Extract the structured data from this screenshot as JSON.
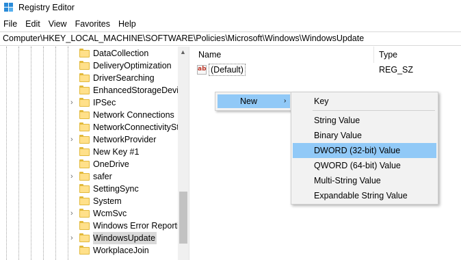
{
  "window": {
    "title": "Registry Editor"
  },
  "menubar": [
    "File",
    "Edit",
    "View",
    "Favorites",
    "Help"
  ],
  "address": "Computer\\HKEY_LOCAL_MACHINE\\SOFTWARE\\Policies\\Microsoft\\Windows\\WindowsUpdate",
  "tree": {
    "items": [
      {
        "label": "DataCollection",
        "expandable": false
      },
      {
        "label": "DeliveryOptimization",
        "expandable": false
      },
      {
        "label": "DriverSearching",
        "expandable": false
      },
      {
        "label": "EnhancedStorageDevices",
        "expandable": false
      },
      {
        "label": "IPSec",
        "expandable": true
      },
      {
        "label": "Network Connections",
        "expandable": false
      },
      {
        "label": "NetworkConnectivityStatusIndicator",
        "expandable": false
      },
      {
        "label": "NetworkProvider",
        "expandable": true
      },
      {
        "label": "New Key #1",
        "expandable": false
      },
      {
        "label": "OneDrive",
        "expandable": false
      },
      {
        "label": "safer",
        "expandable": true
      },
      {
        "label": "SettingSync",
        "expandable": false
      },
      {
        "label": "System",
        "expandable": false
      },
      {
        "label": "WcmSvc",
        "expandable": true
      },
      {
        "label": "Windows Error Reporting",
        "expandable": false
      },
      {
        "label": "WindowsUpdate",
        "expandable": true,
        "selected": true
      },
      {
        "label": "WorkplaceJoin",
        "expandable": false
      }
    ]
  },
  "values": {
    "headers": {
      "name": "Name",
      "type": "Type"
    },
    "rows": [
      {
        "icon": "string-value-icon",
        "icon_text": "ab",
        "name": "(Default)",
        "type": "REG_SZ"
      }
    ]
  },
  "context_menu": {
    "item": "New",
    "arrow": "›"
  },
  "submenu": {
    "first": "Key",
    "items": [
      "String Value",
      "Binary Value",
      "DWORD (32-bit) Value",
      "QWORD (64-bit) Value",
      "Multi-String Value",
      "Expandable String Value"
    ],
    "highlighted_index": 2
  },
  "colors": {
    "highlight": "#91c9f7",
    "selection": "#d9d9d9",
    "folder": "#ffe08a"
  }
}
